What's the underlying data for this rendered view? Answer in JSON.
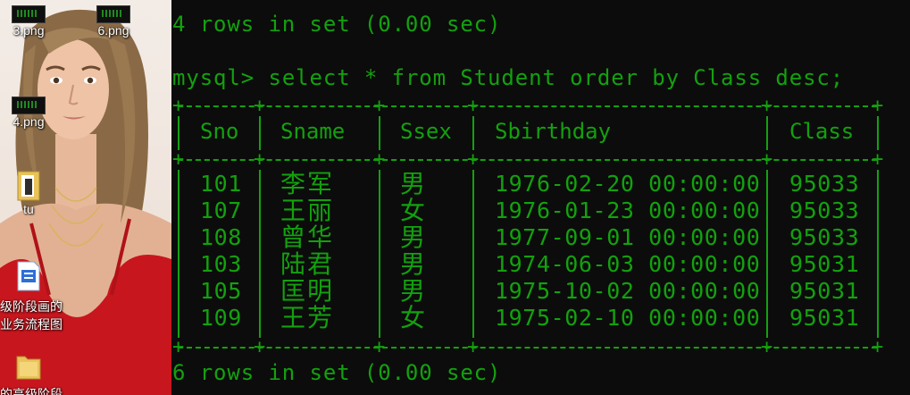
{
  "desktop": {
    "icons": [
      {
        "label": "3.png",
        "icon": "terminal-screenshot-thumbnail"
      },
      {
        "label": "6.png",
        "icon": "terminal-screenshot-thumbnail"
      },
      {
        "label": "4.png",
        "icon": "terminal-screenshot-thumbnail"
      },
      {
        "label": "tu",
        "icon": "folder-icon"
      },
      {
        "label_line1": "级阶段画的",
        "label_line2": "业务流程图",
        "icon": "document-icon"
      },
      {
        "label": "的高级阶段",
        "icon": "folder-icon"
      }
    ]
  },
  "terminal": {
    "prev_result": "4 rows in set (0.00 sec)",
    "prompt": "mysql>",
    "command": "select * from Student order by Class desc;",
    "columns": [
      "Sno",
      "Sname",
      "Ssex",
      "Sbirthday",
      "Class"
    ],
    "rows": [
      [
        "101",
        "李军",
        "男",
        "1976-02-20 00:00:00",
        "95033"
      ],
      [
        "107",
        "王丽",
        "女",
        "1976-01-23 00:00:00",
        "95033"
      ],
      [
        "108",
        "曾华",
        "男",
        "1977-09-01 00:00:00",
        "95033"
      ],
      [
        "103",
        "陆君",
        "男",
        "1974-06-03 00:00:00",
        "95031"
      ],
      [
        "105",
        "匡明",
        "男",
        "1975-10-02 00:00:00",
        "95031"
      ],
      [
        "109",
        "王芳",
        "女",
        "1975-02-10 00:00:00",
        "95031"
      ]
    ],
    "result_footer": "6 rows in set (0.00 sec)",
    "text_color": "#13a10e",
    "background": "#0c0c0c"
  }
}
